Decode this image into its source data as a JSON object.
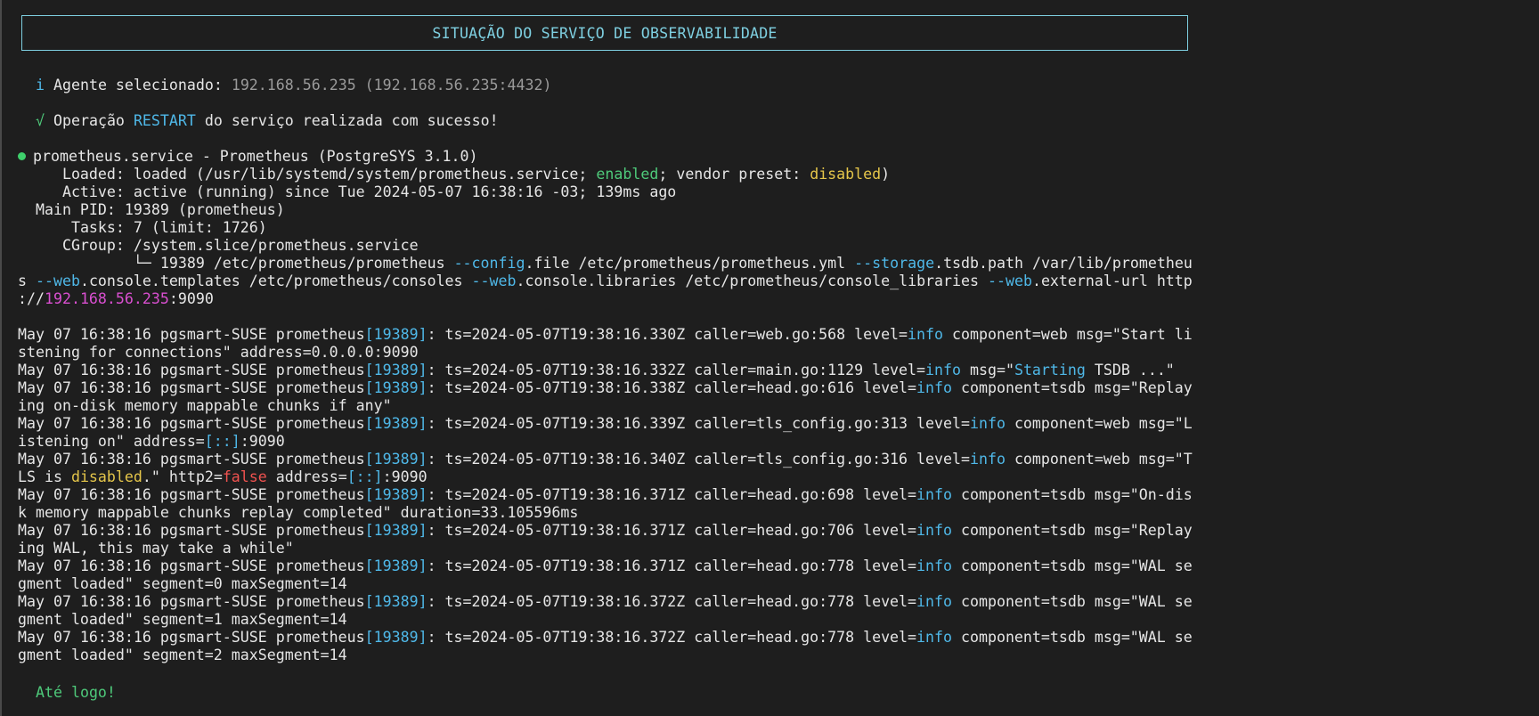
{
  "banner": {
    "title": "SITUAÇÃO DO SERVIÇO DE OBSERVABILIDADE"
  },
  "agent": {
    "icon": "info-icon",
    "icon_glyph": "i",
    "label": "Agente selecionado:",
    "value": "192.168.56.235 (192.168.56.235:4432)"
  },
  "operation": {
    "icon": "check-icon",
    "icon_glyph": "√",
    "prefix": "Operação",
    "action": "RESTART",
    "suffix": "do serviço realizada com sucesso!"
  },
  "service": {
    "status_dot_color": "#3ecf6b",
    "header": "prometheus.service - Prometheus (PostgreSYS 3.1.0)",
    "loaded_label": "Loaded:",
    "loaded_prefix": "loaded (/usr/lib/systemd/system/prometheus.service;",
    "loaded_enabled": "enabled",
    "loaded_mid": "; vendor preset:",
    "loaded_preset": "disabled",
    "loaded_end": ")",
    "active_label": "Active:",
    "active_value": "active (running) since Tue 2024-05-07 16:38:16 -03; 139ms ago",
    "pid_label": "Main PID:",
    "pid_value": "19389 (prometheus)",
    "tasks_label": "Tasks:",
    "tasks_value": "7 (limit: 1726)",
    "cgroup_label": "CGroup:",
    "cgroup_value": "/system.slice/prometheus.service",
    "proc_tree": "└─",
    "proc_pid": "19389",
    "proc_bin": "/etc/prometheus/prometheus",
    "flag1": "--config",
    "flag1_rest": ".file /etc/prometheus/prometheus.yml",
    "flag2": "--storage",
    "flag2_rest": ".tsdb.path /var/lib/promethe",
    "wrap1_start": "u",
    "wrap2_pre": "s",
    "flag3": "--web",
    "flag3_rest": ".console.templates /etc/prometheus/consoles",
    "flag4": "--web",
    "flag4_rest": ".console.libraries /etc/prometheus/console_libraries",
    "flag5": "--web",
    "flag5_rest": ".external-url http",
    "url_pre": "://",
    "url_host": "192.168.56.235",
    "url_port": ":9090"
  },
  "logs": {
    "prefix": "May 07 16:38:16 pgsmart-SUSE prometheus",
    "pid": "[19389]",
    "level_info": "info",
    "entries": [
      {
        "ts": ": ts=2024-05-07T19:38:16.330Z caller=web.go:568 level=",
        "rest": " component=web msg=\"Start li",
        "cont": "stening for connections\" address=0.0.0.0:9090"
      },
      {
        "ts": ": ts=2024-05-07T19:38:16.332Z caller=main.go:1129 level=",
        "rest_pre": " msg=\"",
        "rest_hl": "Starting",
        "rest_post": " TSDB ...\""
      },
      {
        "ts": ": ts=2024-05-07T19:38:16.338Z caller=head.go:616 level=",
        "rest": " component=tsdb msg=\"Replay",
        "cont": "ing on-disk memory mappable chunks if any\""
      },
      {
        "ts": ": ts=2024-05-07T19:38:16.339Z caller=tls_config.go:313 level=",
        "rest": " component=web msg=\"L",
        "cont_pre": "istening on\" address=",
        "cont_hl": "[::]",
        "cont_post": ":9090"
      },
      {
        "ts": ": ts=2024-05-07T19:38:16.340Z caller=tls_config.go:316 level=",
        "rest": " component=web msg=\"T",
        "cont_a": "LS is ",
        "cont_b": "disabled",
        "cont_c": ".\" http2=",
        "cont_d": "false",
        "cont_e": " address=",
        "cont_f": "[::]",
        "cont_g": ":9090"
      },
      {
        "ts": ": ts=2024-05-07T19:38:16.371Z caller=head.go:698 level=",
        "rest": " component=tsdb msg=\"On-dis",
        "cont": "k memory mappable chunks replay completed\" duration=33.105596ms"
      },
      {
        "ts": ": ts=2024-05-07T19:38:16.371Z caller=head.go:706 level=",
        "rest": " component=tsdb msg=\"Replay",
        "cont": "ing WAL, this may take a while\""
      },
      {
        "ts": ": ts=2024-05-07T19:38:16.371Z caller=head.go:778 level=",
        "rest": " component=tsdb msg=\"WAL se",
        "cont": "gment loaded\" segment=0 maxSegment=14"
      },
      {
        "ts": ": ts=2024-05-07T19:38:16.372Z caller=head.go:778 level=",
        "rest": " component=tsdb msg=\"WAL se",
        "cont": "gment loaded\" segment=1 maxSegment=14"
      },
      {
        "ts": ": ts=2024-05-07T19:38:16.372Z caller=head.go:778 level=",
        "rest": " component=tsdb msg=\"WAL se",
        "cont": "gment loaded\" segment=2 maxSegment=14"
      }
    ]
  },
  "farewell": "Até logo!",
  "colors": {
    "background": "#1e1e1e",
    "text": "#e6e6e6",
    "cyan": "#4fb8e8",
    "green": "#4ec97a",
    "yellow": "#e5c64a",
    "red": "#f0524f",
    "magenta": "#d94fd0",
    "banner_border": "#7ecfe0"
  }
}
